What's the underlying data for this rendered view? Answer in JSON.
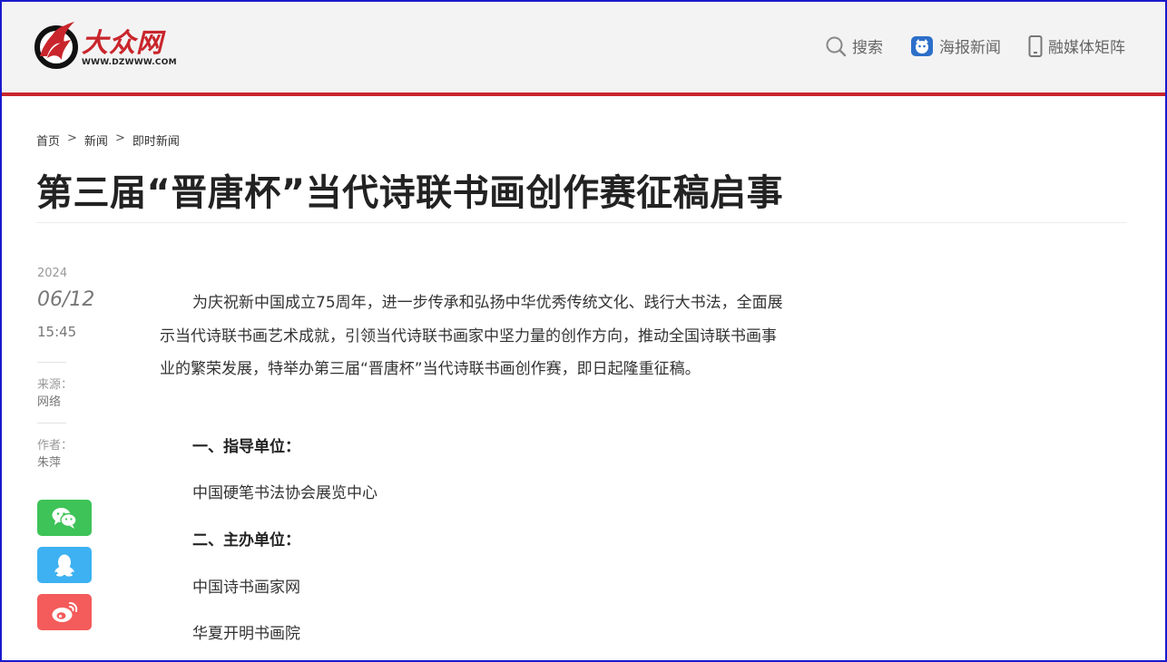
{
  "header": {
    "logo_text": "大众网",
    "logo_url": "WWW.DZWWW.COM",
    "nav": [
      {
        "label": "搜索",
        "icon": "search-icon"
      },
      {
        "label": "海报新闻",
        "icon": "poster-news-icon"
      },
      {
        "label": "融媒体矩阵",
        "icon": "phone-icon"
      }
    ],
    "accent_color": "#c9252c"
  },
  "breadcrumb": {
    "items": [
      "首页",
      "新闻",
      "即时新闻"
    ],
    "separator": ">"
  },
  "article": {
    "title": "第三届“晋唐杯”当代诗联书画创作赛征稿启事",
    "year": "2024",
    "date": "06/12",
    "time": "15:45",
    "source_label": "来源：",
    "source": "网络",
    "author_label": "作者：",
    "author": "朱萍",
    "intro": "为庆祝新中国成立75周年，进一步传承和弘扬中华优秀传统文化、践行大书法，全面展示当代诗联书画艺术成就，引领当代诗联书画家中坚力量的创作方向，推动全国诗联书画事业的繁荣发展，特举办第三届“晋唐杯”当代诗联书画创作赛，即日起隆重征稿。",
    "sections": [
      {
        "heading": "一、指导单位：",
        "items": [
          "中国硬笔书法协会展览中心"
        ]
      },
      {
        "heading": "二、主办单位：",
        "items": [
          "中国诗书画家网",
          "华夏开明书画院"
        ]
      }
    ]
  },
  "share": [
    {
      "name": "wechat",
      "icon": "wechat-icon",
      "color": "#3ec358"
    },
    {
      "name": "qq",
      "icon": "qq-icon",
      "color": "#3db1f2"
    },
    {
      "name": "weibo",
      "icon": "weibo-icon",
      "color": "#f45b5b"
    }
  ]
}
